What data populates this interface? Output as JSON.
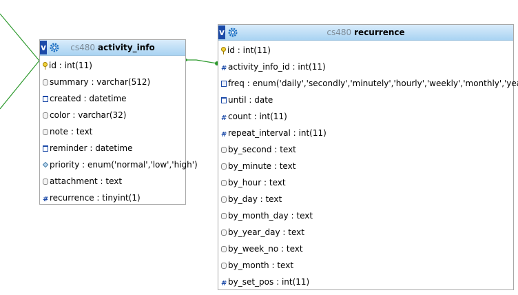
{
  "tables": {
    "activity_info": {
      "db": "cs480",
      "name": "activity_info",
      "columns": [
        {
          "icon": "key-icon",
          "text": "id : int(11)"
        },
        {
          "icon": "text-icon",
          "text": "summary : varchar(512)"
        },
        {
          "icon": "date-icon",
          "text": "created : datetime"
        },
        {
          "icon": "text-icon",
          "text": "color : varchar(32)"
        },
        {
          "icon": "text-icon",
          "text": "note : text"
        },
        {
          "icon": "date-icon",
          "text": "reminder : datetime"
        },
        {
          "icon": "enum-icon",
          "text": "priority : enum('normal','low','high')"
        },
        {
          "icon": "text-icon",
          "text": "attachment : text"
        },
        {
          "icon": "hash-icon",
          "text": "recurrence : tinyint(1)"
        }
      ]
    },
    "recurrence": {
      "db": "cs480",
      "name": "recurrence",
      "columns": [
        {
          "icon": "key-icon",
          "text": "id : int(11)"
        },
        {
          "icon": "hash-icon",
          "text": "activity_info_id : int(11)"
        },
        {
          "icon": "enum-blue-icon",
          "text": "freq : enum('daily','secondly','minutely','hourly','weekly','monthly','yearly')"
        },
        {
          "icon": "date-icon",
          "text": "until : date"
        },
        {
          "icon": "hash-icon",
          "text": "count : int(11)"
        },
        {
          "icon": "hash-icon",
          "text": "repeat_interval : int(11)"
        },
        {
          "icon": "text-icon",
          "text": "by_second : text"
        },
        {
          "icon": "text-icon",
          "text": "by_minute : text"
        },
        {
          "icon": "text-icon",
          "text": "by_hour : text"
        },
        {
          "icon": "text-icon",
          "text": "by_day : text"
        },
        {
          "icon": "text-icon",
          "text": "by_month_day : text"
        },
        {
          "icon": "text-icon",
          "text": "by_year_day : text"
        },
        {
          "icon": "text-icon",
          "text": "by_week_no : text"
        },
        {
          "icon": "text-icon",
          "text": "by_month : text"
        },
        {
          "icon": "hash-icon",
          "text": "by_set_pos : int(11)"
        }
      ]
    }
  },
  "header_toggle_label": "v",
  "colors": {
    "relation_line": "#2e9a2e",
    "header_top": "#d9ecfb",
    "header_bottom": "#a9d3f2",
    "toggle": "#1b4aa8"
  }
}
